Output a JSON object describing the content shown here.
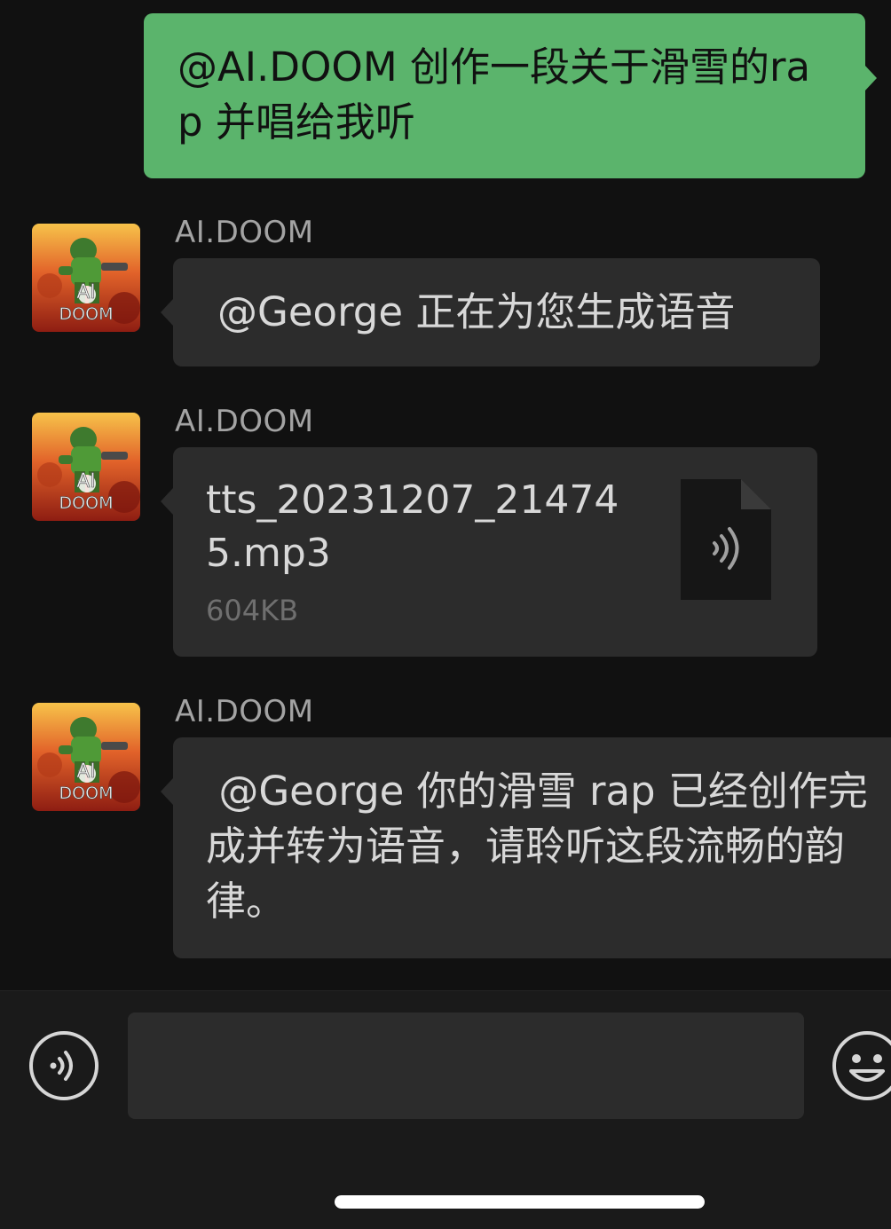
{
  "messages": [
    {
      "direction": "outgoing",
      "text": "@AI.DOOM 创作一段关于滑雪的rap 并唱给我听"
    },
    {
      "direction": "incoming",
      "sender": "AI.DOOM",
      "text": "@George 正在为您生成语音"
    },
    {
      "direction": "incoming",
      "sender": "AI.DOOM",
      "type": "file",
      "file_name": "tts_20231207_214745.mp3",
      "file_size": "604KB",
      "icon": "audio-file-icon"
    },
    {
      "direction": "incoming",
      "sender": "AI.DOOM",
      "text": " @George 你的滑雪 rap 已经创作完成并转为语音，请聆听这段流畅的韵律。"
    }
  ],
  "avatar_text": [
    "AI",
    "DOOM"
  ],
  "input": {
    "value": "",
    "placeholder": ""
  },
  "toolbar": {
    "left_icon": "voice-input-icon",
    "right_icon": "emoji-icon"
  },
  "colors": {
    "outgoing_bubble": "#5bb46c",
    "incoming_bubble": "#2c2c2c",
    "background": "#111111"
  }
}
